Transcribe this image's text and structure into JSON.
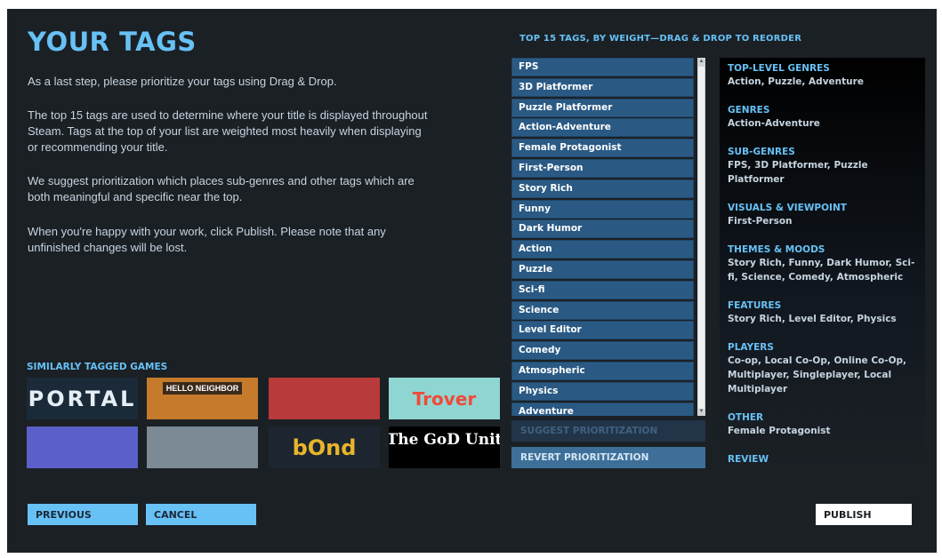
{
  "page": {
    "title": "YOUR TAGS",
    "paragraphs": [
      "As a last step, please prioritize your tags using Drag & Drop.",
      "The top 15 tags are used to determine where your title is displayed throughout Steam. Tags at the top of your list are weighted most heavily when displaying or recommending your title.",
      "We suggest prioritization which places sub-genres and other tags which are both meaningful and specific near the top.",
      "When you're happy with your work, click Publish. Please note that any unfinished changes will be lost."
    ]
  },
  "similar": {
    "heading": "SIMILARLY TAGGED GAMES",
    "games": [
      {
        "label": "PORTAL",
        "icon": "portal-game-icon",
        "bg": "#1a2a38",
        "fg": "#e6eef5"
      },
      {
        "label": "HELLO NEIGHBOR",
        "icon": "hello-neighbor-game-icon",
        "bg": "#c57a2c",
        "fg": "#ffffff"
      },
      {
        "label": "",
        "icon": "mirrors-edge-game-icon",
        "bg": "#b83a3a",
        "fg": "#ffffff"
      },
      {
        "label": "Trover",
        "icon": "trover-game-icon",
        "bg": "#8fd6d2",
        "fg": "#f04a3a"
      },
      {
        "label": "",
        "icon": "angry-bunny-game-icon",
        "bg": "#5a60c8",
        "fg": "#ffffff"
      },
      {
        "label": "",
        "icon": "quantum-conundrum-game-icon",
        "bg": "#7b8a95",
        "fg": "#ffffff"
      },
      {
        "label": "bOnd",
        "icon": "boond-game-icon",
        "bg": "#1d2630",
        "fg": "#e8b52c"
      },
      {
        "label": "The GoD Unit",
        "icon": "god-unit-game-icon",
        "bg": "#000000",
        "fg": "#ffffff"
      }
    ]
  },
  "tags": {
    "heading": "TOP 15 TAGS, BY WEIGHT—DRAG & DROP TO REORDER",
    "items": [
      "FPS",
      "3D Platformer",
      "Puzzle Platformer",
      "Action-Adventure",
      "Female Protagonist",
      "First-Person",
      "Story Rich",
      "Funny",
      "Dark Humor",
      "Action",
      "Puzzle",
      "Sci-fi",
      "Science",
      "Level Editor",
      "Comedy",
      "Atmospheric",
      "Physics",
      "Adventure"
    ]
  },
  "buttons": {
    "suggest": "SUGGEST PRIORITIZATION",
    "revert": "REVERT PRIORITIZATION",
    "previous": "PREVIOUS",
    "cancel": "CANCEL",
    "publish": "PUBLISH"
  },
  "categories": [
    {
      "title": "TOP-LEVEL GENRES",
      "values": "Action, Puzzle, Adventure"
    },
    {
      "title": "GENRES",
      "values": "Action-Adventure"
    },
    {
      "title": "SUB-GENRES",
      "values": "FPS, 3D Platformer, Puzzle Platformer"
    },
    {
      "title": "VISUALS & VIEWPOINT",
      "values": "First-Person"
    },
    {
      "title": "THEMES & MOODS",
      "values": "Story Rich, Funny, Dark Humor, Sci-fi, Science, Comedy, Atmospheric"
    },
    {
      "title": "FEATURES",
      "values": "Story Rich, Level Editor, Physics"
    },
    {
      "title": "PLAYERS",
      "values": "Co-op, Local Co-Op, Online Co-Op, Multiplayer, Singleplayer, Local Multiplayer"
    },
    {
      "title": "OTHER",
      "values": "Female Protagonist"
    },
    {
      "title": "REVIEW",
      "values": ""
    }
  ],
  "colors": {
    "accent": "#67c1f5",
    "tag_bg": "#2a5a84",
    "panel_bg": "#1b2025"
  }
}
